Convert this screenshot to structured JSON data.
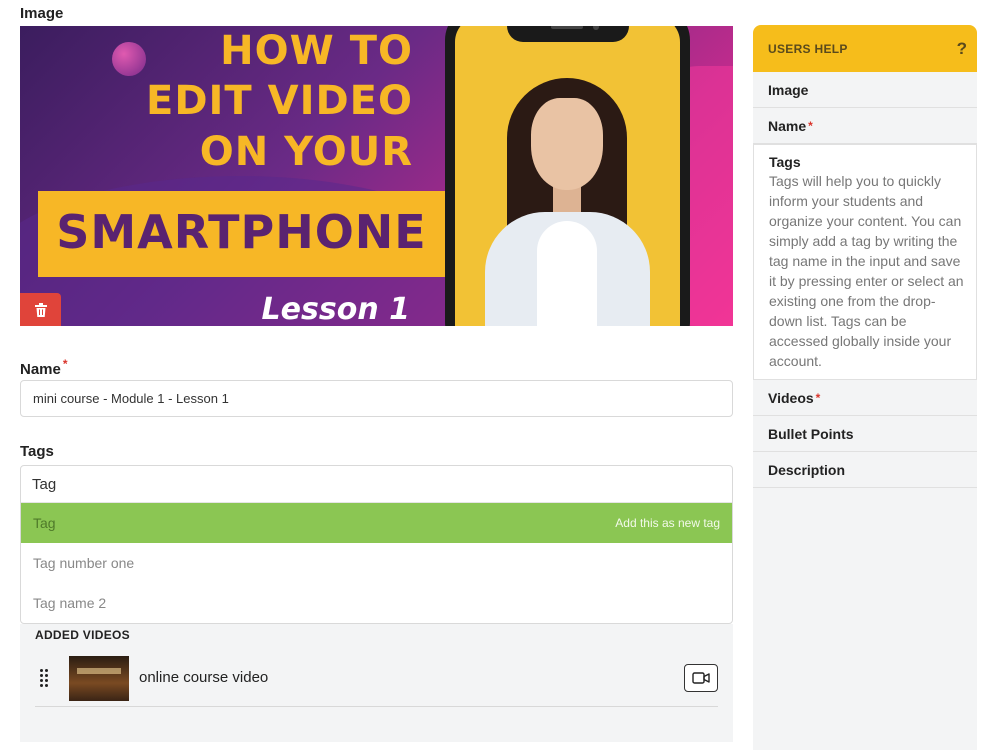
{
  "image_section": {
    "label": "Image",
    "thumbnail": {
      "line1": "HOW TO",
      "line2": "EDIT VIDEO",
      "line3": "ON YOUR",
      "banner": "SMARTPHONE",
      "lesson": "Lesson 1"
    },
    "delete_icon": "trash-icon"
  },
  "name_field": {
    "label": "Name",
    "required_mark": "*",
    "value": "mini course - Module 1 - Lesson 1"
  },
  "tags_field": {
    "label": "Tags",
    "value": "Tag",
    "options": [
      {
        "label": "Tag",
        "hint": "Add this as new tag"
      },
      {
        "label": "Tag number one",
        "hint": ""
      },
      {
        "label": "Tag name 2",
        "hint": ""
      }
    ]
  },
  "added_videos": {
    "title": "ADDED VIDEOS",
    "items": [
      {
        "title": "online course video",
        "icon": "video-camera-icon"
      }
    ]
  },
  "users_help": {
    "title": "USERS HELP",
    "help_icon": "?",
    "items": [
      {
        "label": "Image",
        "required": ""
      },
      {
        "label": "Name",
        "required": "*"
      },
      {
        "label": "Tags",
        "required": "",
        "description": "Tags will help you to quickly inform your students and organize your content. You can simply add a tag by writing the tag name in the input and save it by pressing enter or select an existing one from the drop-down list. Tags can be accessed globally inside your account."
      },
      {
        "label": "Videos",
        "required": "*"
      },
      {
        "label": "Bullet Points",
        "required": ""
      },
      {
        "label": "Description",
        "required": ""
      }
    ]
  },
  "colors": {
    "accent_yellow": "#f6bd1b",
    "highlight_green": "#8bc653",
    "delete_red": "#e0443a",
    "required_red": "#d9342b"
  }
}
